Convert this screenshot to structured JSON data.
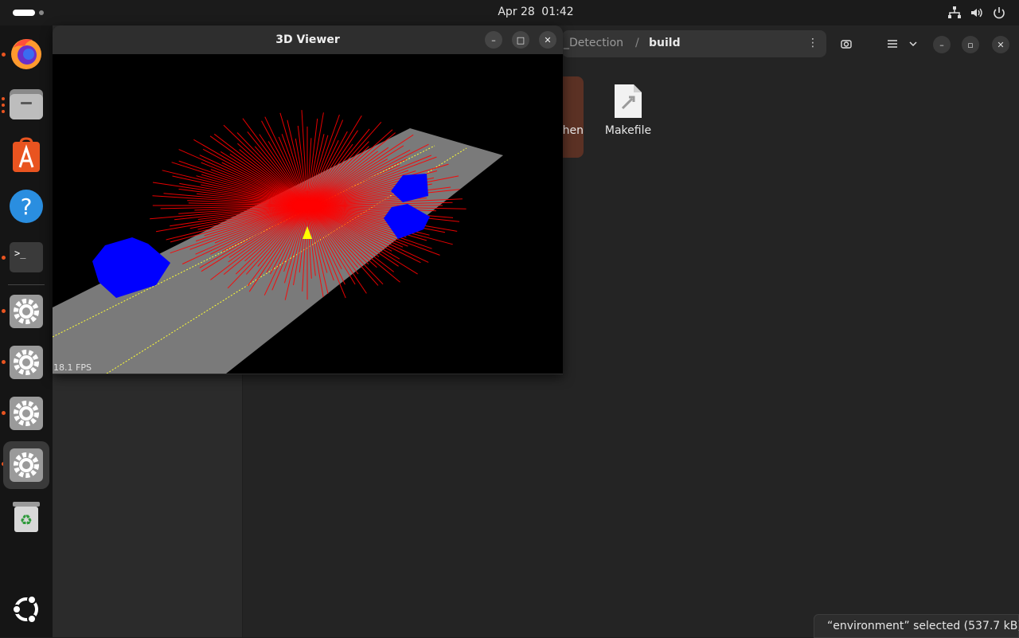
{
  "topbar": {
    "date": "Apr 28",
    "time": "01:42",
    "tray_icons": [
      "network-icon",
      "volume-icon",
      "power-icon"
    ]
  },
  "dock": {
    "apps": [
      "firefox",
      "files",
      "app-center",
      "help",
      "terminal",
      "settings",
      "settings",
      "settings",
      "settings",
      "trash",
      "show-apps"
    ]
  },
  "files_window": {
    "path_segments": [
      "_Detection",
      "build"
    ],
    "path_separator": "/",
    "items": [
      {
        "label": "hen",
        "type": "folder-partial"
      },
      {
        "label": "Makefile",
        "type": "makefile"
      }
    ],
    "status": "“environment” selected  (537.7 kB)"
  },
  "viewer": {
    "title": "3D Viewer",
    "fps_label": "18.1 FPS",
    "colors": {
      "background": "#000000",
      "road": "#7a7a7a",
      "lane_marking": "#ffff00",
      "lidar_rays": "#ff0000",
      "cars": "#0000ff"
    }
  }
}
